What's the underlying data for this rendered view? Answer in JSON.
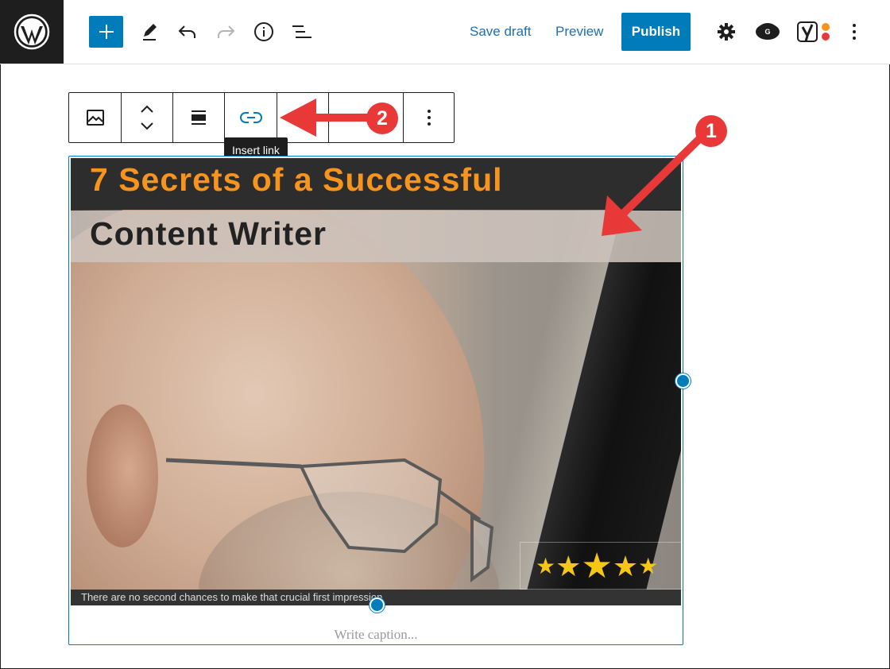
{
  "toolbar": {
    "save_draft": "Save draft",
    "preview": "Preview",
    "publish": "Publish",
    "icons": [
      "wordpress-icon",
      "plus-icon",
      "pencil-icon",
      "undo-icon",
      "redo-icon",
      "info-icon",
      "list-view-icon",
      "gear-icon",
      "grammarly-icon",
      "yoast-icon",
      "more-vertical-icon"
    ]
  },
  "block_toolbar": {
    "tooltip": "Insert link",
    "icons": [
      "image-icon",
      "move-up-down-icon",
      "align-icon",
      "link-icon",
      "more-vertical-icon"
    ]
  },
  "image": {
    "title_line1": "7 Secrets of a Successful",
    "title_line2": "Content Writer",
    "tagline": "There are no second chances to make that crucial first impression",
    "stars": 5
  },
  "caption_placeholder": "Write caption...",
  "annotations": {
    "badge1": "1",
    "badge2": "2"
  },
  "colors": {
    "accent": "#007cba",
    "annotation": "#e93838",
    "title_orange": "#f7941d"
  }
}
